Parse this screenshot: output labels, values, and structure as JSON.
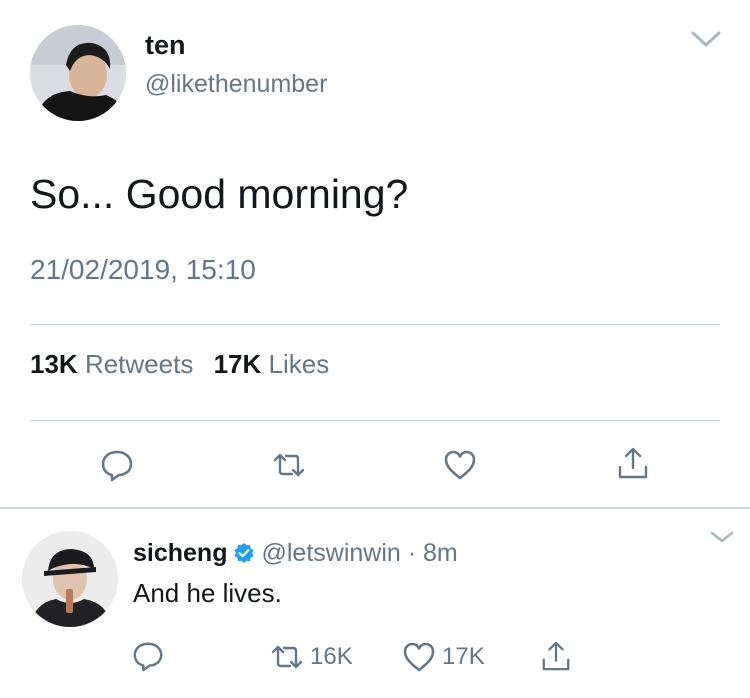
{
  "main_tweet": {
    "author_name": "ten",
    "author_handle": "@likethenumber",
    "text": "So... Good morning?",
    "timestamp": "21/02/2019, 15:10",
    "retweets_count": "13K",
    "retweets_label": "Retweets",
    "likes_count": "17K",
    "likes_label": "Likes",
    "actions": [
      "reply-icon",
      "retweet-icon",
      "like-icon",
      "share-icon"
    ]
  },
  "reply_tweet": {
    "author_name": "sicheng",
    "verified": true,
    "author_handle": "@letswinwin",
    "separator": "·",
    "time_ago": "8m",
    "text": "And he lives.",
    "retweets_count": "16K",
    "likes_count": "17K"
  },
  "colors": {
    "text_primary": "#14171a",
    "text_secondary": "#657786",
    "divider": "#ccd6dd",
    "verified_blue": "#1da1f2"
  }
}
